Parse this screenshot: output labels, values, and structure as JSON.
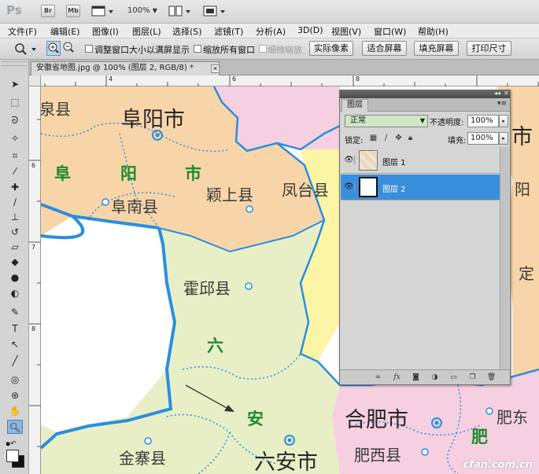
{
  "app": {
    "logo": "Ps",
    "bridge_button": "Br",
    "minibridge_button": "Mb",
    "zoom_level": "100%"
  },
  "menu": [
    "文件(F)",
    "编辑(E)",
    "图像(I)",
    "图层(L)",
    "选择(S)",
    "滤镜(T)",
    "分析(A)",
    "3D(D)",
    "视图(V)",
    "窗口(W)",
    "帮助(H)"
  ],
  "options": {
    "resize_windows_label": "调整窗口大小以满屏显示",
    "zoom_all_windows_label": "缩放所有窗口",
    "scrubby_zoom_label": "细微缩放",
    "actual_pixels_button": "实际像素",
    "fit_screen_button": "适合屏幕",
    "fill_screen_button": "填充屏幕",
    "print_size_button": "打印尺寸"
  },
  "document": {
    "tab_title": "安徽省地图.jpg @ 100% (图层 2, RGB/8) *",
    "ruler_h_ticks": [
      "4",
      "6",
      "8"
    ],
    "ruler_v_ticks": [
      "6",
      "7",
      "8"
    ]
  },
  "map": {
    "cities": [
      "阜阳市",
      "合肥市",
      "六安市"
    ],
    "counties": [
      "泉县",
      "阜南县",
      "颖上县",
      "凤台县",
      "霍邱县",
      "金寨县",
      "肥西县",
      "肥东"
    ],
    "region_chars": [
      "阜",
      "阳",
      "市",
      "六",
      "安",
      "肥"
    ],
    "partial_labels": [
      "市",
      "阳",
      "定"
    ],
    "watermark": "cfan.com.cn"
  },
  "layers_panel": {
    "tab_label": "图层",
    "blend_mode": "正常",
    "opacity_label": "不透明度:",
    "opacity_value": "100%",
    "lock_label": "锁定:",
    "fill_label": "填充:",
    "fill_value": "100%",
    "layers": [
      {
        "name": "图层 1",
        "visible": true,
        "selected": false
      },
      {
        "name": "图层 2",
        "visible": true,
        "selected": true
      }
    ]
  },
  "colors": {
    "selection_blue": "#3a8fdc",
    "map_orange": "#f8d5a8",
    "map_green": "#e8efc6",
    "map_yellow": "#fdf5a6",
    "map_pink": "#f6cfe0",
    "border_blue": "#2a8ee0"
  }
}
